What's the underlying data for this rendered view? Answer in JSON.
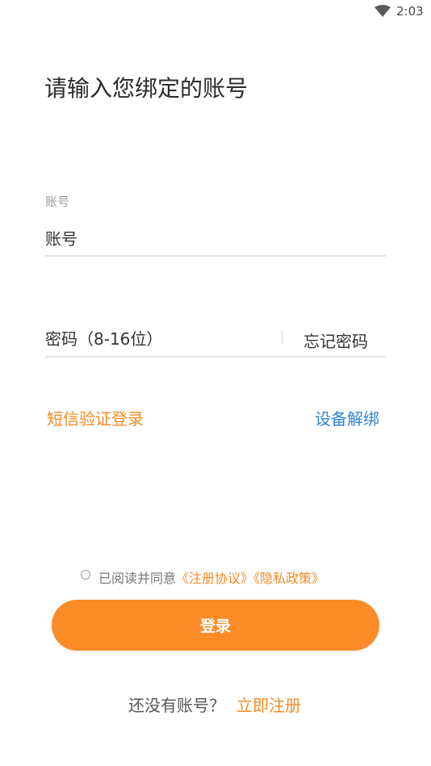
{
  "status_bar": {
    "time": "2:03",
    "wifi_icon": "wifi-icon"
  },
  "title": "请输入您绑定的账号",
  "account": {
    "label": "账号",
    "placeholder": "账号"
  },
  "password": {
    "placeholder": "密码（8-16位）",
    "forgot_label": "忘记密码"
  },
  "links": {
    "sms_login": "短信验证登录",
    "unbind_device": "设备解绑"
  },
  "agreement": {
    "prefix": "已阅读并同意",
    "terms": "《注册协议》",
    "privacy": "《隐私政策》",
    "checked": false
  },
  "login_button": "登录",
  "register": {
    "question": "还没有账号？",
    "link": "立即注册"
  },
  "colors": {
    "accent": "#fb8b26",
    "link_orange": "#f58a24",
    "link_blue": "#2f86d6"
  }
}
